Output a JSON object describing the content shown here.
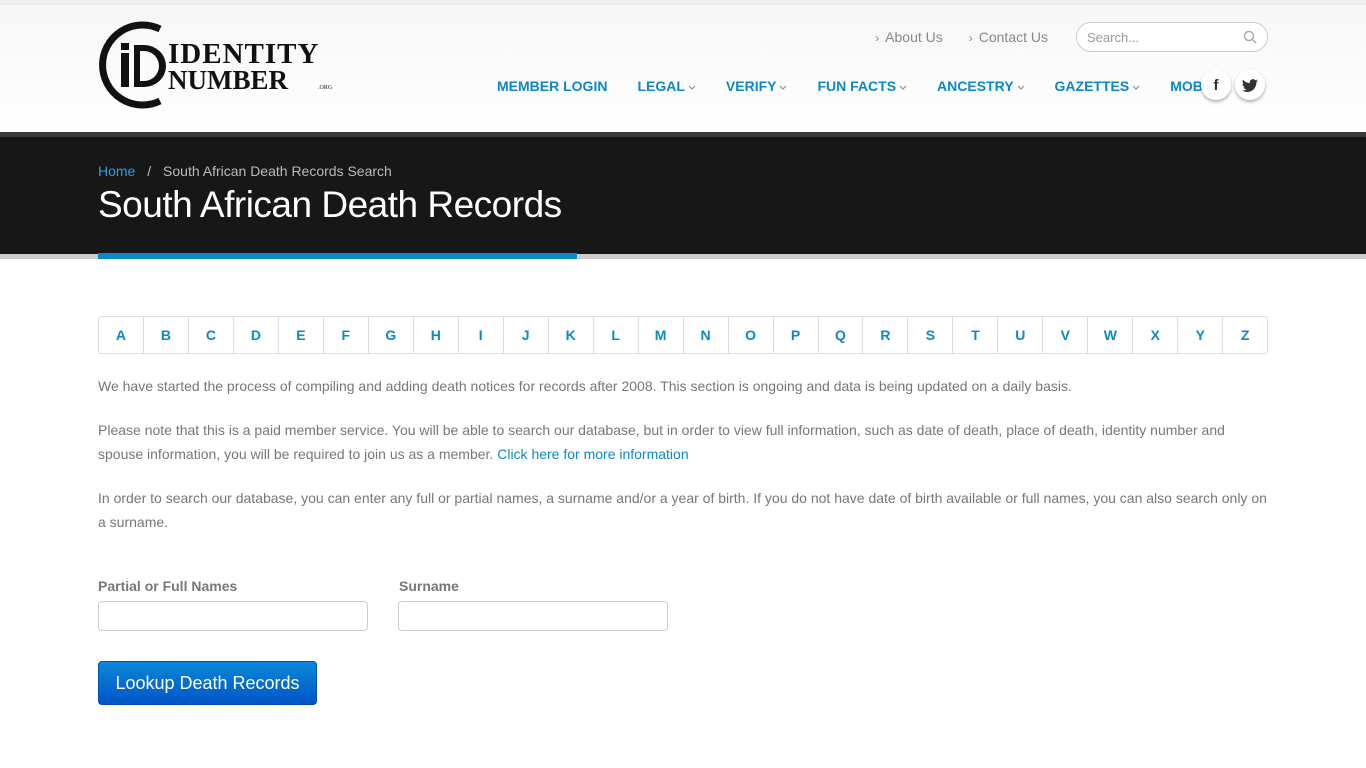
{
  "logo": {
    "line1": "IDENTITY",
    "line2": "NUMBER",
    "suffix": ".ORG"
  },
  "toplinks": [
    "About Us",
    "Contact Us"
  ],
  "search": {
    "placeholder": "Search..."
  },
  "nav": [
    {
      "label": "MEMBER LOGIN",
      "dd": false
    },
    {
      "label": "LEGAL",
      "dd": true
    },
    {
      "label": "VERIFY",
      "dd": true
    },
    {
      "label": "FUN FACTS",
      "dd": true
    },
    {
      "label": "ANCESTRY",
      "dd": true
    },
    {
      "label": "GAZETTES",
      "dd": true
    },
    {
      "label": "MOBILE",
      "dd": false
    }
  ],
  "social": {
    "facebook": "f"
  },
  "breadcrumb": {
    "home": "Home",
    "sep": "/",
    "current": "South African Death Records Search"
  },
  "title": "South African Death Records",
  "letters": [
    "A",
    "B",
    "C",
    "D",
    "E",
    "F",
    "G",
    "H",
    "I",
    "J",
    "K",
    "L",
    "M",
    "N",
    "O",
    "P",
    "Q",
    "R",
    "S",
    "T",
    "U",
    "V",
    "W",
    "X",
    "Y",
    "Z"
  ],
  "paragraphs": {
    "p1": "We have started the process of compiling and adding death notices for records after 2008. This section is ongoing and data is being updated on a daily basis.",
    "p2": "Please note that this is a paid member service. You will be able to search our database, but in order to view full information, such as date of death, place of death, identity number and spouse information, you will be required to join us as a member. ",
    "p2_link": "Click here for more information",
    "p3": "In order to search our database, you can enter any full or partial names, a surname and/or a year of birth. If you do not have date of birth available or full names, you can also search only on a surname."
  },
  "form": {
    "names_label": "Partial or Full Names",
    "surname_label": "Surname",
    "submit": "Lookup Death Records"
  },
  "colors": {
    "accent": "#0a88c8",
    "hero": "#171717"
  }
}
